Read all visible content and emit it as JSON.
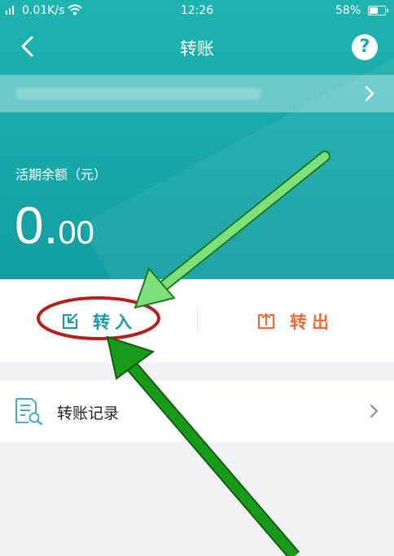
{
  "status_bar": {
    "signal": "❙❙",
    "speed": "0.01K/s",
    "time": "12:26",
    "battery": "58%"
  },
  "header": {
    "title": "转账",
    "help_label": "?"
  },
  "balance": {
    "label": "活期余额（元）",
    "integer": "0.",
    "decimal": "00"
  },
  "actions": {
    "transfer_in": "转入",
    "transfer_out": "转出"
  },
  "menu": {
    "records_label": "转账记录"
  },
  "icons": {
    "back": "back-arrow-icon",
    "help": "help-icon",
    "account_chevron": "chevron-right-icon",
    "transfer_in": "transfer-in-icon",
    "transfer_out": "transfer-out-icon",
    "records": "document-search-icon",
    "records_chevron": "chevron-right-icon"
  },
  "colors": {
    "header_teal": "#1ba9a9",
    "transfer_in": "#1b9aa6",
    "transfer_out": "#f06b3a",
    "annotation_arrow_light": "#7ee07a",
    "annotation_arrow_dark": "#1a9a1a",
    "annotation_circle": "#b3221f"
  }
}
